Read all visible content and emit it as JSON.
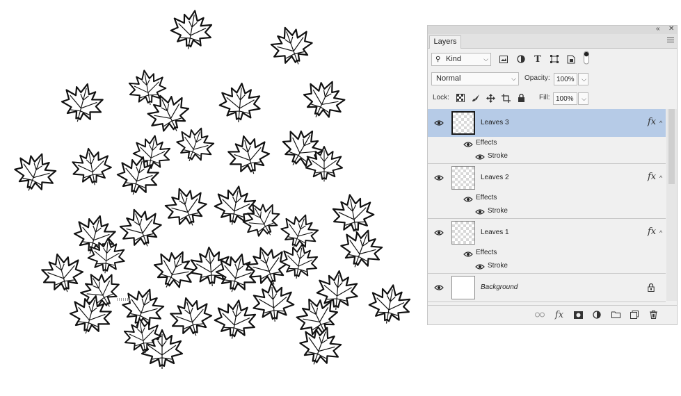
{
  "panel": {
    "tab_label": "Layers",
    "collapse_glyph": "«",
    "close_glyph": "✕"
  },
  "filter": {
    "kind_label": "Kind",
    "icons": [
      "image-filter-icon",
      "adjustment-filter-icon",
      "type-filter-icon",
      "shape-filter-icon",
      "smart-object-filter-icon",
      "filter-toggle-icon"
    ]
  },
  "blend": {
    "mode": "Normal",
    "opacity_label": "Opacity:",
    "opacity_value": "100%"
  },
  "lock": {
    "label": "Lock:",
    "fill_label": "Fill:",
    "fill_value": "100%"
  },
  "layers": [
    {
      "name": "Leaves 3",
      "selected": true,
      "fx": "fx",
      "effects_label": "Effects",
      "stroke_label": "Stroke"
    },
    {
      "name": "Leaves 2",
      "selected": false,
      "fx": "fx",
      "effects_label": "Effects",
      "stroke_label": "Stroke"
    },
    {
      "name": "Leaves 1",
      "selected": false,
      "fx": "fx",
      "effects_label": "Effects",
      "stroke_label": "Stroke"
    },
    {
      "name": "Background",
      "selected": false
    }
  ],
  "footer_icons": [
    "link-layers-icon",
    "add-style-icon",
    "add-mask-icon",
    "new-adjustment-icon",
    "new-group-icon",
    "new-layer-icon",
    "delete-layer-icon"
  ],
  "colors": {
    "selection": "#b6cbe7",
    "panel_bg": "#f0f0f0"
  }
}
